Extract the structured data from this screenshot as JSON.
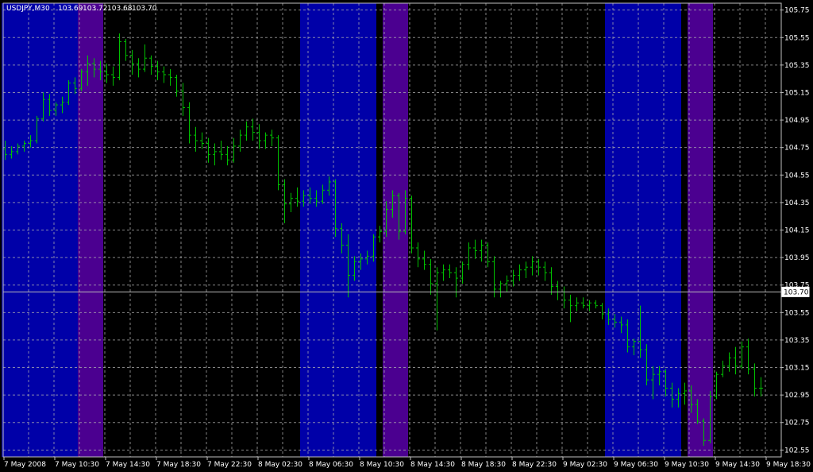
{
  "chart_data": {
    "type": "ohlc",
    "title": "USDJPY,M30",
    "quote": {
      "open": "103.69",
      "high": "103.72",
      "low": "103.68",
      "close": "103.70"
    },
    "current_price_label": "103.70",
    "current_price": 103.7,
    "ylim": [
      102.5,
      105.8
    ],
    "y_ticks": [
      "105.75",
      "105.55",
      "105.35",
      "105.15",
      "104.95",
      "104.75",
      "104.55",
      "104.35",
      "104.15",
      "103.95",
      "103.75",
      "103.55",
      "103.35",
      "103.15",
      "102.95",
      "102.75",
      "102.55"
    ],
    "x_ticks": [
      "7 May 2008",
      "7 May 10:30",
      "7 May 14:30",
      "7 May 18:30",
      "7 May 22:30",
      "8 May 02:30",
      "8 May 06:30",
      "8 May 10:30",
      "8 May 14:30",
      "8 May 18:30",
      "8 May 22:30",
      "9 May 02:30",
      "9 May 06:30",
      "9 May 10:30",
      "9 May 14:30",
      "9 May 18:30"
    ],
    "grid": true,
    "bar_color": "#00c000",
    "background": "#000000",
    "grid_color": "#b0b0b0",
    "session_colors": {
      "blue": "#0000a8",
      "purple": "#4b0090"
    },
    "sessions": [
      {
        "color": "blue",
        "start_bar": 0,
        "end_bar": 11
      },
      {
        "color": "purple",
        "start_bar": 12,
        "end_bar": 15
      },
      {
        "color": "blue",
        "start_bar": 47,
        "end_bar": 58
      },
      {
        "color": "purple",
        "start_bar": 60,
        "end_bar": 63
      },
      {
        "color": "blue",
        "start_bar": 95,
        "end_bar": 106
      },
      {
        "color": "purple",
        "start_bar": 108,
        "end_bar": 111
      }
    ],
    "bars": [
      [
        104.74,
        104.8,
        104.66,
        104.7
      ],
      [
        104.7,
        104.76,
        104.67,
        104.72
      ],
      [
        104.72,
        104.78,
        104.7,
        104.76
      ],
      [
        104.76,
        104.8,
        104.72,
        104.78
      ],
      [
        104.78,
        104.84,
        104.75,
        104.8
      ],
      [
        104.8,
        104.98,
        104.78,
        104.96
      ],
      [
        104.96,
        105.15,
        104.94,
        105.1
      ],
      [
        105.1,
        105.14,
        104.98,
        105.02
      ],
      [
        105.02,
        105.08,
        104.98,
        105.06
      ],
      [
        105.06,
        105.12,
        105.0,
        105.08
      ],
      [
        105.08,
        105.24,
        105.06,
        105.22
      ],
      [
        105.22,
        105.26,
        105.14,
        105.18
      ],
      [
        105.18,
        105.32,
        105.16,
        105.3
      ],
      [
        105.3,
        105.42,
        105.2,
        105.36
      ],
      [
        105.36,
        105.4,
        105.26,
        105.32
      ],
      [
        105.32,
        105.38,
        105.24,
        105.3
      ],
      [
        105.3,
        105.36,
        105.22,
        105.28
      ],
      [
        105.28,
        105.34,
        105.2,
        105.26
      ],
      [
        105.26,
        105.58,
        105.24,
        105.52
      ],
      [
        105.52,
        105.54,
        105.38,
        105.42
      ],
      [
        105.42,
        105.46,
        105.28,
        105.36
      ],
      [
        105.36,
        105.4,
        105.26,
        105.32
      ],
      [
        105.32,
        105.5,
        105.3,
        105.4
      ],
      [
        105.4,
        105.42,
        105.28,
        105.34
      ],
      [
        105.34,
        105.38,
        105.24,
        105.3
      ],
      [
        105.3,
        105.34,
        105.22,
        105.28
      ],
      [
        105.28,
        105.32,
        105.2,
        105.26
      ],
      [
        105.26,
        105.28,
        105.12,
        105.16
      ],
      [
        105.16,
        105.22,
        104.98,
        105.04
      ],
      [
        105.04,
        105.08,
        104.78,
        104.84
      ],
      [
        104.84,
        104.9,
        104.72,
        104.8
      ],
      [
        104.8,
        104.86,
        104.74,
        104.78
      ],
      [
        104.78,
        104.82,
        104.64,
        104.7
      ],
      [
        104.7,
        104.78,
        104.62,
        104.72
      ],
      [
        104.72,
        104.8,
        104.66,
        104.7
      ],
      [
        104.7,
        104.76,
        104.62,
        104.66
      ],
      [
        104.66,
        104.82,
        104.64,
        104.76
      ],
      [
        104.76,
        104.88,
        104.72,
        104.84
      ],
      [
        104.84,
        104.94,
        104.8,
        104.9
      ],
      [
        104.9,
        104.96,
        104.8,
        104.86
      ],
      [
        104.86,
        104.92,
        104.74,
        104.8
      ],
      [
        104.8,
        104.86,
        104.74,
        104.84
      ],
      [
        104.84,
        104.88,
        104.76,
        104.82
      ],
      [
        104.82,
        104.84,
        104.44,
        104.48
      ],
      [
        104.48,
        104.52,
        104.2,
        104.34
      ],
      [
        104.34,
        104.42,
        104.28,
        104.38
      ],
      [
        104.38,
        104.46,
        104.32,
        104.36
      ],
      [
        104.36,
        104.44,
        104.32,
        104.4
      ],
      [
        104.4,
        104.46,
        104.34,
        104.38
      ],
      [
        104.38,
        104.44,
        104.32,
        104.36
      ],
      [
        104.36,
        104.48,
        104.34,
        104.44
      ],
      [
        104.44,
        104.54,
        104.4,
        104.5
      ],
      [
        104.5,
        104.52,
        104.1,
        104.16
      ],
      [
        104.16,
        104.2,
        103.98,
        104.04
      ],
      [
        104.04,
        104.12,
        103.66,
        103.82
      ],
      [
        103.82,
        103.96,
        103.78,
        103.92
      ],
      [
        103.92,
        103.98,
        103.86,
        103.94
      ],
      [
        103.94,
        104.0,
        103.9,
        103.96
      ],
      [
        103.96,
        104.12,
        103.92,
        104.1
      ],
      [
        104.1,
        104.18,
        104.06,
        104.14
      ],
      [
        104.14,
        104.36,
        104.1,
        104.3
      ],
      [
        104.3,
        104.44,
        104.24,
        104.4
      ],
      [
        104.4,
        104.42,
        104.08,
        104.14
      ],
      [
        104.14,
        104.44,
        104.12,
        104.38
      ],
      [
        104.38,
        104.4,
        103.98,
        104.02
      ],
      [
        104.02,
        104.06,
        103.88,
        103.94
      ],
      [
        103.94,
        104.0,
        103.86,
        103.9
      ],
      [
        103.9,
        103.94,
        103.68,
        103.76
      ],
      [
        103.76,
        103.88,
        103.42,
        103.84
      ],
      [
        103.84,
        103.9,
        103.78,
        103.86
      ],
      [
        103.86,
        103.9,
        103.8,
        103.84
      ],
      [
        103.84,
        103.88,
        103.66,
        103.8
      ],
      [
        103.8,
        103.92,
        103.76,
        103.9
      ],
      [
        103.9,
        104.06,
        103.86,
        104.02
      ],
      [
        104.02,
        104.08,
        103.94,
        104.0
      ],
      [
        104.0,
        104.08,
        103.92,
        104.04
      ],
      [
        104.04,
        104.06,
        103.88,
        103.92
      ],
      [
        103.92,
        103.96,
        103.66,
        103.72
      ],
      [
        103.72,
        103.78,
        103.66,
        103.76
      ],
      [
        103.76,
        103.82,
        103.7,
        103.78
      ],
      [
        103.78,
        103.86,
        103.74,
        103.82
      ],
      [
        103.82,
        103.9,
        103.78,
        103.86
      ],
      [
        103.86,
        103.92,
        103.8,
        103.88
      ],
      [
        103.88,
        103.96,
        103.82,
        103.92
      ],
      [
        103.92,
        103.94,
        103.82,
        103.88
      ],
      [
        103.88,
        103.92,
        103.78,
        103.84
      ],
      [
        103.84,
        103.88,
        103.68,
        103.74
      ],
      [
        103.74,
        103.78,
        103.64,
        103.7
      ],
      [
        103.7,
        103.74,
        103.58,
        103.64
      ],
      [
        103.64,
        103.68,
        103.48,
        103.6
      ],
      [
        103.6,
        103.66,
        103.56,
        103.62
      ],
      [
        103.62,
        103.66,
        103.58,
        103.6
      ],
      [
        103.6,
        103.64,
        103.56,
        103.62
      ],
      [
        103.62,
        103.64,
        103.58,
        103.6
      ],
      [
        103.6,
        103.62,
        103.5,
        103.54
      ],
      [
        103.54,
        103.58,
        103.46,
        103.5
      ],
      [
        103.5,
        103.54,
        103.44,
        103.48
      ],
      [
        103.48,
        103.52,
        103.4,
        103.46
      ],
      [
        103.46,
        103.5,
        103.26,
        103.3
      ],
      [
        103.3,
        103.36,
        103.24,
        103.34
      ],
      [
        103.34,
        103.6,
        103.22,
        103.28
      ],
      [
        103.28,
        103.32,
        103.02,
        103.06
      ],
      [
        103.06,
        103.16,
        102.92,
        103.1
      ],
      [
        103.1,
        103.16,
        103.02,
        103.12
      ],
      [
        103.12,
        103.14,
        102.94,
        103.0
      ],
      [
        103.0,
        103.04,
        102.86,
        102.92
      ],
      [
        102.92,
        103.0,
        102.86,
        102.96
      ],
      [
        102.96,
        103.04,
        102.88,
        102.98
      ],
      [
        102.98,
        103.02,
        102.82,
        102.88
      ],
      [
        102.88,
        102.92,
        102.74,
        102.76
      ],
      [
        102.76,
        102.78,
        102.58,
        102.62
      ],
      [
        102.62,
        102.98,
        102.6,
        102.94
      ],
      [
        102.94,
        103.12,
        102.92,
        103.1
      ],
      [
        103.1,
        103.2,
        103.08,
        103.16
      ],
      [
        103.16,
        103.26,
        103.12,
        103.22
      ],
      [
        103.22,
        103.3,
        103.1,
        103.16
      ],
      [
        103.16,
        103.34,
        103.14,
        103.3
      ],
      [
        103.3,
        103.36,
        103.1,
        103.14
      ],
      [
        103.14,
        103.18,
        102.94,
        103.0
      ],
      [
        103.0,
        103.08,
        102.94,
        103.0
      ]
    ]
  }
}
